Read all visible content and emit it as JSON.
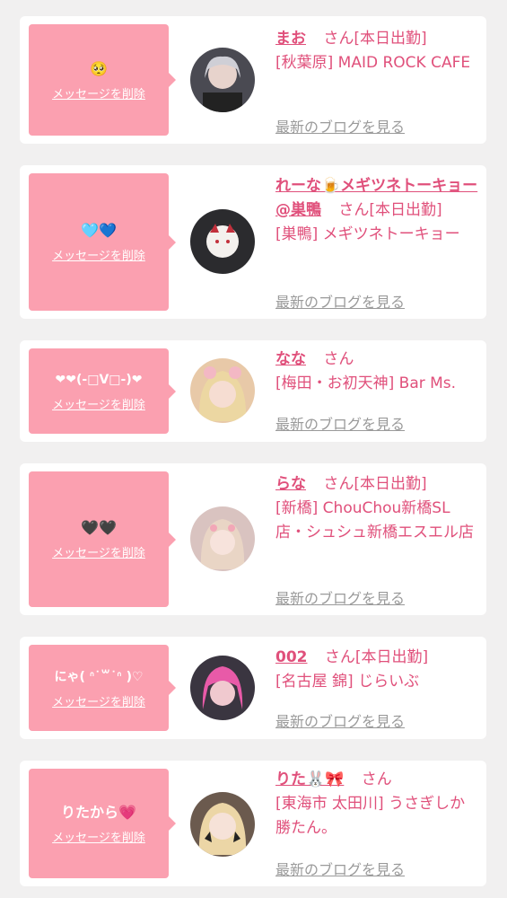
{
  "delete_label": "メッセージを削除",
  "blog_label": "最新のブログを見る",
  "honorific": "さん",
  "colors": {
    "bubble": "#fba0b0",
    "accent": "#e0507b",
    "link_gray": "#9a9a9a"
  },
  "items": [
    {
      "message": "🥺",
      "name": "まお",
      "status": "[本日出勤]",
      "shop": "[秋葉原] MAID ROCK CAFE"
    },
    {
      "message": "🩵💙",
      "name": "れーな🍺メギツネトーキョー@巣鴨",
      "status": "[本日出勤]",
      "shop": "[巣鴨] メギツネトーキョー"
    },
    {
      "message": "❤❤(-□V□-)❤",
      "name": "なな",
      "status": "",
      "shop": "[梅田・お初天神] Bar Ms."
    },
    {
      "message": "🖤🖤",
      "name": "らな",
      "status": "[本日出勤]",
      "shop": "[新橋] ChouChou新橋SL店・シュシュ新橋エスエル店"
    },
    {
      "message": "にゃ( ᐢ˙꒳˙ᐢ )♡",
      "name": "002",
      "status": "[本日出勤]",
      "shop": "[名古屋 錦] じらいぶ"
    },
    {
      "message": "りたから💗",
      "name": "りた🐰🎀",
      "status": "",
      "shop": "[東海市 太田川] うさぎしか勝たん。"
    }
  ]
}
